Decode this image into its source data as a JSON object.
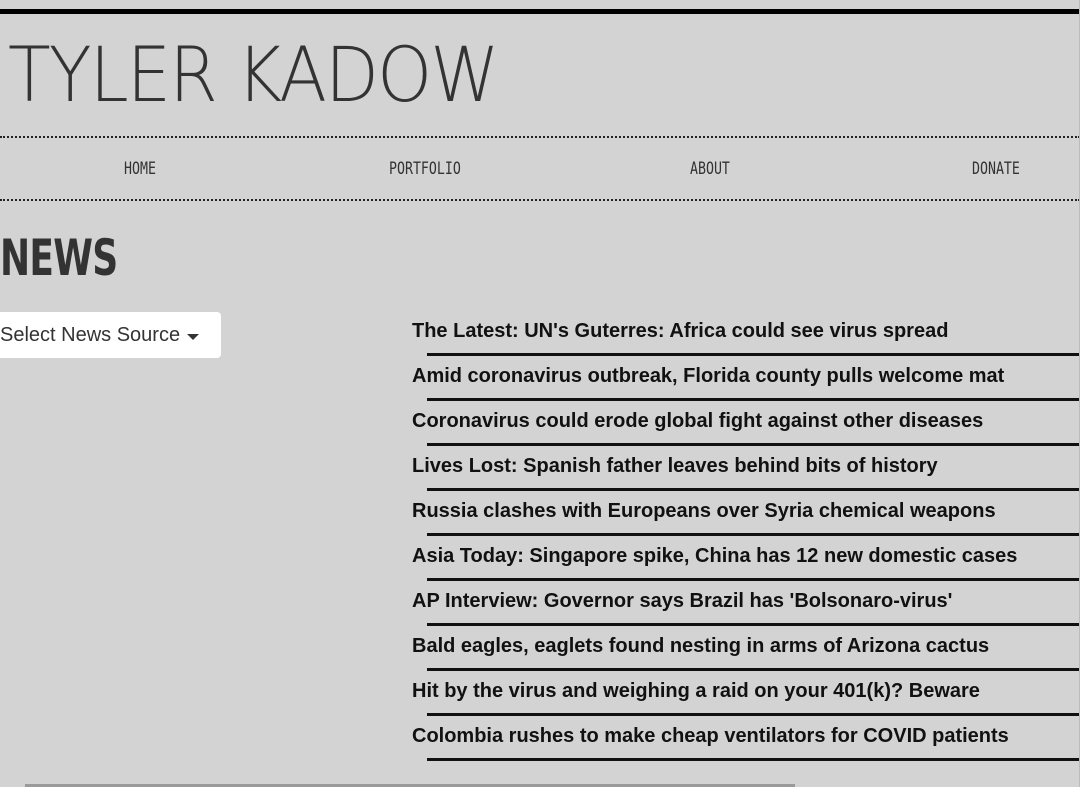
{
  "site": {
    "logo_text": "TYLER KADOW"
  },
  "nav": {
    "items": [
      {
        "label": "HOME"
      },
      {
        "label": "PORTFOLIO"
      },
      {
        "label": "ABOUT"
      },
      {
        "label": "DONATE"
      }
    ]
  },
  "page": {
    "title": "NEWS"
  },
  "news_source": {
    "label": "Select News Source"
  },
  "headlines": [
    "The Latest: UN's Guterres: Africa could see virus spread",
    "Amid coronavirus outbreak, Florida county pulls welcome mat",
    "Coronavirus could erode global fight against other diseases",
    "Lives Lost: Spanish father leaves behind bits of history",
    "Russia clashes with Europeans over Syria chemical weapons",
    "Asia Today: Singapore spike, China has 12 new domestic cases",
    "AP Interview: Governor says Brazil has 'Bolsonaro-virus'",
    "Bald eagles, eaglets found nesting in arms of Arizona cactus",
    "Hit by the virus and weighing a raid on your 401(k)? Beware",
    "Colombia rushes to make cheap ventilators for COVID patients"
  ]
}
